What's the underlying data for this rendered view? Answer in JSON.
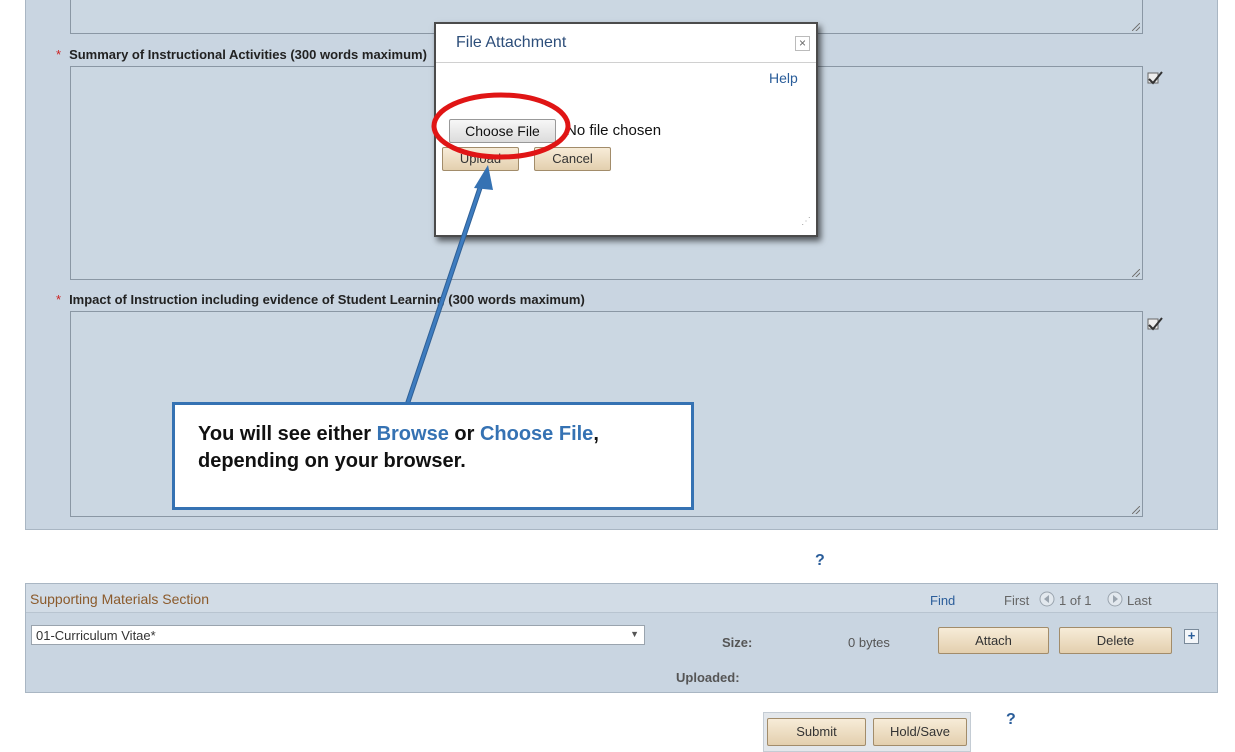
{
  "form": {
    "field1": {
      "label": "Summary of Instructional Activities (300 words maximum)",
      "required": "*"
    },
    "field2": {
      "label": "Impact of Instruction including evidence of Student Learning (300 words maximum)",
      "required": "*"
    },
    "help_mark": "?"
  },
  "modal": {
    "title": "File Attachment",
    "close": "×",
    "help_link": "Help",
    "choose_file_label": "Choose File",
    "no_file_text": "No file chosen",
    "upload_label": "Upload",
    "cancel_label": "Cancel"
  },
  "callout": {
    "prefix": "You will see either ",
    "browse": "Browse",
    "or": " or ",
    "choose": "Choose File",
    "suffix": ", depending on your browser."
  },
  "supporting": {
    "title": "Supporting Materials Section",
    "find": "Find",
    "first": "First",
    "pager": "1 of 1",
    "last": "Last",
    "select_value": "01-Curriculum Vitae*",
    "size_label": "Size:",
    "size_value": "0 bytes",
    "uploaded_label": "Uploaded:",
    "attach_label": "Attach",
    "delete_label": "Delete",
    "add_label": "+"
  },
  "footer": {
    "submit_label": "Submit",
    "holdsave_label": "Hold/Save",
    "help_mark": "?"
  },
  "colors": {
    "accent": "#3572b3",
    "required": "#cc2222",
    "annotation_red": "#e01515"
  }
}
